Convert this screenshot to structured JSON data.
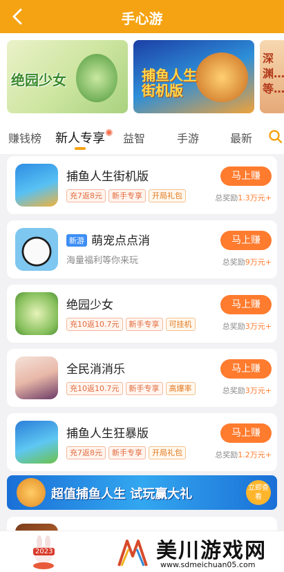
{
  "header": {
    "title": "手心游"
  },
  "banners": [
    {
      "text": "绝园少女"
    },
    {
      "text": "捕鱼人生街机版"
    },
    {
      "text": "深渊…等…"
    }
  ],
  "tabs": [
    {
      "label": "赚钱榜"
    },
    {
      "label": "新人专享"
    },
    {
      "label": "益智"
    },
    {
      "label": "手游"
    },
    {
      "label": "最新"
    }
  ],
  "games": [
    {
      "name": "捕鱼人生街机版",
      "tags": [
        "充7返8元",
        "新手专享",
        "开局礼包"
      ],
      "button": "马上赚",
      "reward_prefix": "总奖励",
      "reward_value": "1.3万元+"
    },
    {
      "badge": "新游",
      "name": "萌宠点点消",
      "desc": "海量福利等你来玩",
      "button": "马上赚",
      "reward_prefix": "总奖励",
      "reward_value": "9万元+"
    },
    {
      "name": "绝园少女",
      "tags": [
        "充10返10.7元",
        "新手专享",
        "可挂机"
      ],
      "button": "马上赚",
      "reward_prefix": "总奖励",
      "reward_value": "3万元+"
    },
    {
      "name": "全民消消乐",
      "tags": [
        "充10返10.7元",
        "新手专享",
        "高爆率"
      ],
      "button": "马上赚",
      "reward_prefix": "总奖励",
      "reward_value": "3万元+"
    },
    {
      "name": "捕鱼人生狂暴版",
      "tags": [
        "充7返8元",
        "新手专享",
        "开局礼包"
      ],
      "button": "马上赚",
      "reward_prefix": "总奖励",
      "reward_value": "1.2万元+"
    }
  ],
  "ad": {
    "text": "超值捕鱼人生 试玩赢大礼",
    "button": "立即查看"
  },
  "footer": {
    "year": "2023",
    "site_name": "美川游戏网",
    "site_url": "www.sdmeichuan05.com"
  },
  "colors": {
    "header": "#f5a312",
    "accent": "#ff7b2e",
    "badge_blue": "#3d8ef4"
  }
}
